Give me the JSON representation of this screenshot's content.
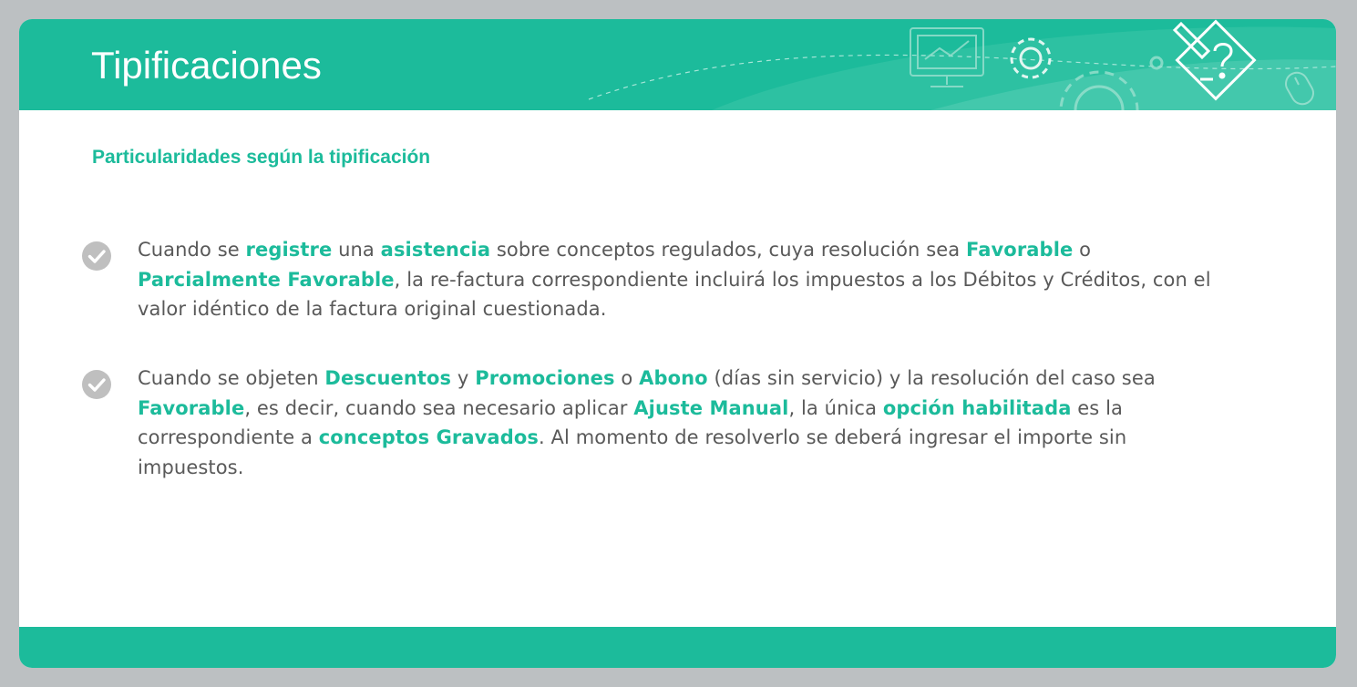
{
  "header": {
    "title": "Tipificaciones",
    "icons": [
      "presentation-board-icon",
      "gear-icon",
      "large-gear-icon",
      "pencil-question-icon",
      "mouse-icon"
    ]
  },
  "subtitle": "Particularidades según la tipificación",
  "bullets": [
    {
      "icon": "check-circle-icon",
      "segments": [
        {
          "text": " Cuando se ",
          "highlight": false
        },
        {
          "text": "registre",
          "highlight": true
        },
        {
          "text": " una ",
          "highlight": false
        },
        {
          "text": "asistencia",
          "highlight": true
        },
        {
          "text": " sobre conceptos regulados, cuya resolución sea ",
          "highlight": false
        },
        {
          "text": "Favorable",
          "highlight": true
        },
        {
          "text": " o ",
          "highlight": false
        },
        {
          "text": "Parcialmente Favorable",
          "highlight": true
        },
        {
          "text": ", la re-factura correspondiente incluirá los impuestos a los Débitos y Créditos, con el valor idéntico de la factura original cuestionada.",
          "highlight": false
        }
      ]
    },
    {
      "icon": "check-circle-icon",
      "segments": [
        {
          "text": " Cuando se objeten ",
          "highlight": false
        },
        {
          "text": "Descuentos",
          "highlight": true
        },
        {
          "text": " y ",
          "highlight": false
        },
        {
          "text": "Promociones",
          "highlight": true
        },
        {
          "text": " o ",
          "highlight": false
        },
        {
          "text": "Abono",
          "highlight": true
        },
        {
          "text": " (días sin servicio)  y la resolución del caso sea ",
          "highlight": false
        },
        {
          "text": "Favorable",
          "highlight": true
        },
        {
          "text": ", es decir, cuando sea necesario aplicar ",
          "highlight": false
        },
        {
          "text": "Ajuste Manual",
          "highlight": true
        },
        {
          "text": ", la única ",
          "highlight": false
        },
        {
          "text": "opción habilitada",
          "highlight": true
        },
        {
          "text": " es la correspondiente a ",
          "highlight": false
        },
        {
          "text": "conceptos Gravados",
          "highlight": true
        },
        {
          "text": ". Al momento de resolverlo se deberá ingresar el importe sin impuestos.",
          "highlight": false
        }
      ]
    }
  ],
  "colors": {
    "accent": "#1cbb9b",
    "body_text": "#595959",
    "check_icon": "#bfbfbf",
    "background": "#bcc0c2"
  }
}
